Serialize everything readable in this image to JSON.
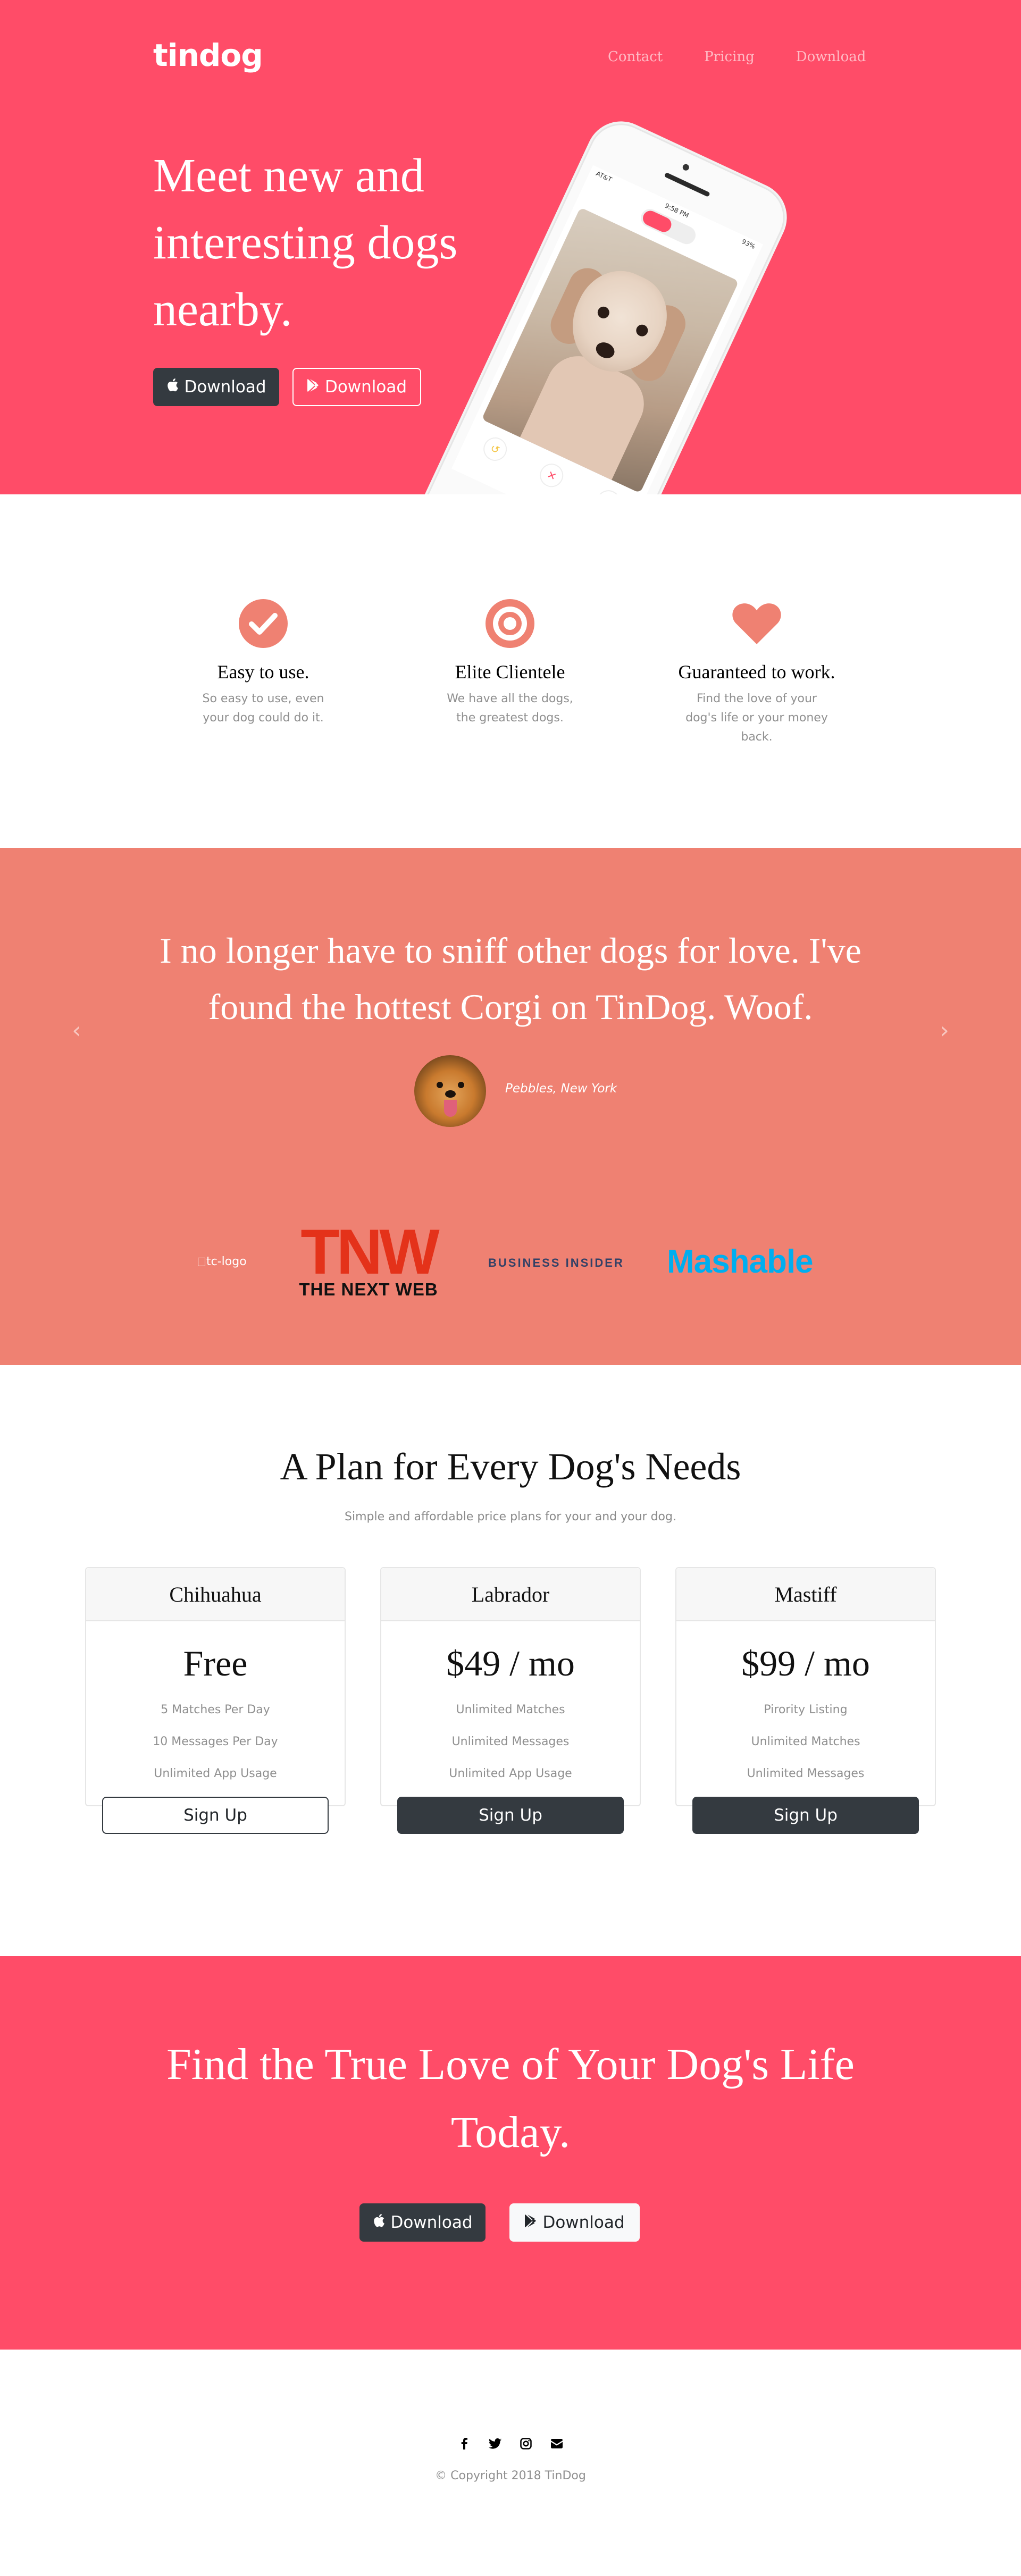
{
  "brand": "tindog",
  "nav": {
    "items": [
      "Contact",
      "Pricing",
      "Download"
    ]
  },
  "hero": {
    "heading": "Meet new and interesting dogs nearby.",
    "apple_button": "Download",
    "google_button": "Download",
    "phone": {
      "carrier": "AT&T",
      "time": "9:58 PM",
      "battery": "93%"
    }
  },
  "features": [
    {
      "icon": "check-circle-icon",
      "title": "Easy to use.",
      "text": "So easy to use, even your dog could do it."
    },
    {
      "icon": "target-icon",
      "title": "Elite Clientele",
      "text": "We have all the dogs, the greatest dogs."
    },
    {
      "icon": "heart-icon",
      "title": "Guaranteed to work.",
      "text": "Find the love of your dog's life or your money back."
    }
  ],
  "testimonial": {
    "quote": "I no longer have to sniff other dogs for love. I've found the hottest Corgi on TinDog. Woof.",
    "author": "Pebbles, New York"
  },
  "press": {
    "tc_alt": "tc-logo",
    "tnw_mark": "TNW",
    "tnw_text": "THE NEXT WEB",
    "business_insider": "BUSINESS INSIDER",
    "mashable": "Mashable"
  },
  "pricing": {
    "title": "A Plan for Every Dog's Needs",
    "subtitle": "Simple and affordable price plans for your and your dog.",
    "plans": [
      {
        "name": "Chihuahua",
        "price": "Free",
        "features": [
          "5 Matches Per Day",
          "10 Messages Per Day",
          "Unlimited App Usage"
        ],
        "button": "Sign Up"
      },
      {
        "name": "Labrador",
        "price": "$49 / mo",
        "features": [
          "Unlimited Matches",
          "Unlimited Messages",
          "Unlimited App Usage"
        ],
        "button": "Sign Up"
      },
      {
        "name": "Mastiff",
        "price": "$99 / mo",
        "features": [
          "Pirority Listing",
          "Unlimited Matches",
          "Unlimited Messages"
        ],
        "button": "Sign Up"
      }
    ]
  },
  "cta": {
    "heading": "Find the True Love of Your Dog's Life Today.",
    "apple_button": "Download",
    "google_button": "Download"
  },
  "footer": {
    "social_icons": [
      "facebook-icon",
      "twitter-icon",
      "instagram-icon",
      "envelope-icon"
    ],
    "copyright": "© Copyright 2018 TinDog"
  },
  "colors": {
    "primary": "#ff4c68",
    "secondary": "#ef8172",
    "dark": "#343a40"
  }
}
